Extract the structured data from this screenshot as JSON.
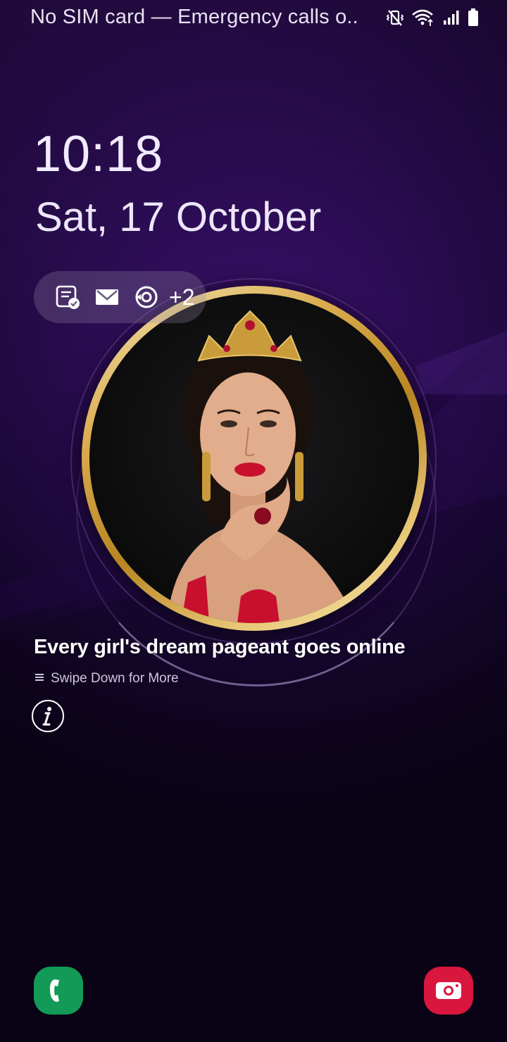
{
  "status_bar": {
    "carrier_text": "No SIM card — Emergency calls o..",
    "icons": [
      "vibrate-mute-icon",
      "wifi-icon",
      "signal-icon",
      "battery-icon"
    ]
  },
  "lockscreen": {
    "time": "10:18",
    "date": "Sat, 17 October"
  },
  "notifications": {
    "icons": [
      "notes-check-icon",
      "mail-icon",
      "sync-app-icon"
    ],
    "more_count": "+2"
  },
  "story": {
    "headline": "Every girl's dream pageant goes online",
    "swipe_hint": "Swipe Down for More",
    "image": "portrait-of-woman-with-crown"
  },
  "shortcuts": {
    "left": "phone-icon",
    "right": "camera-icon"
  },
  "colors": {
    "phone_shortcut": "#129a56",
    "camera_shortcut": "#d8163e",
    "frame_gold": "#d9aa4c"
  }
}
